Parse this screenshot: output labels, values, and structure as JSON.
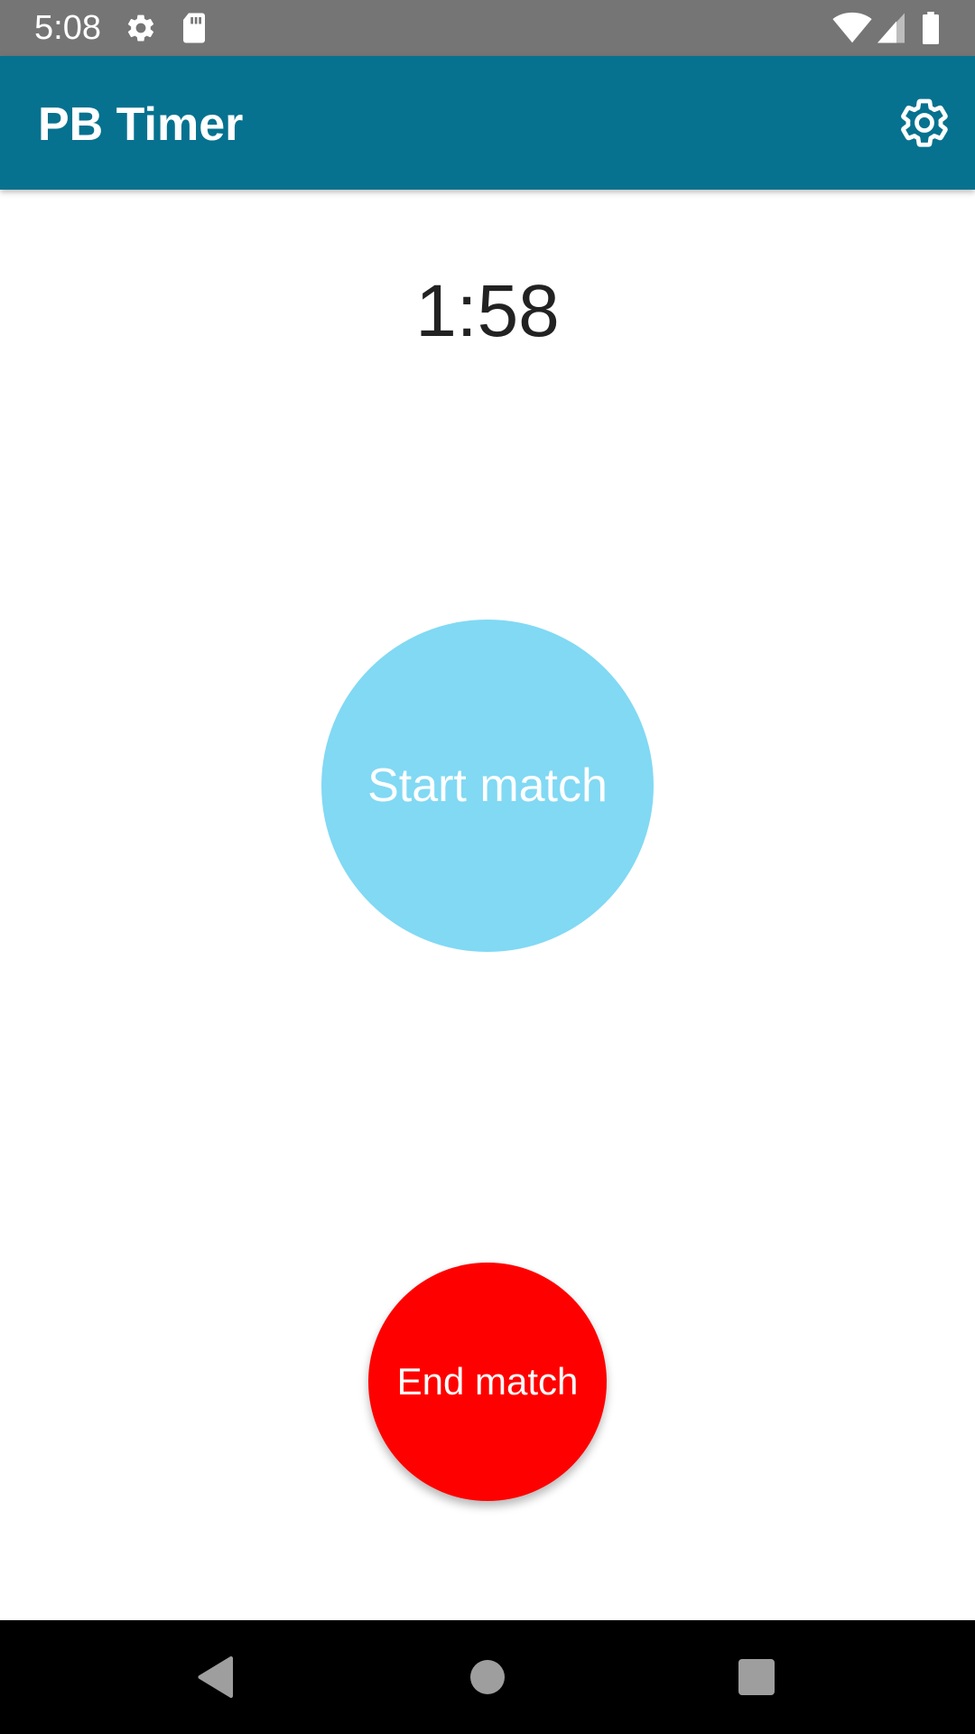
{
  "status_bar": {
    "time": "5:08",
    "left_icons": [
      "gear-icon",
      "sd-card-icon"
    ],
    "right_icons": [
      "wifi-icon",
      "cell-signal-icon",
      "battery-icon"
    ],
    "background": "#757575"
  },
  "app_bar": {
    "title": "PB Timer",
    "settings_icon": "gear-icon",
    "background": "#06728f"
  },
  "timer": {
    "value": "1:58"
  },
  "buttons": {
    "start_label": "Start match",
    "start_color": "#81d9f4",
    "end_label": "End match",
    "end_color": "#ff0000"
  },
  "nav_bar": {
    "icons": [
      "back-icon",
      "home-icon",
      "recents-icon"
    ]
  }
}
